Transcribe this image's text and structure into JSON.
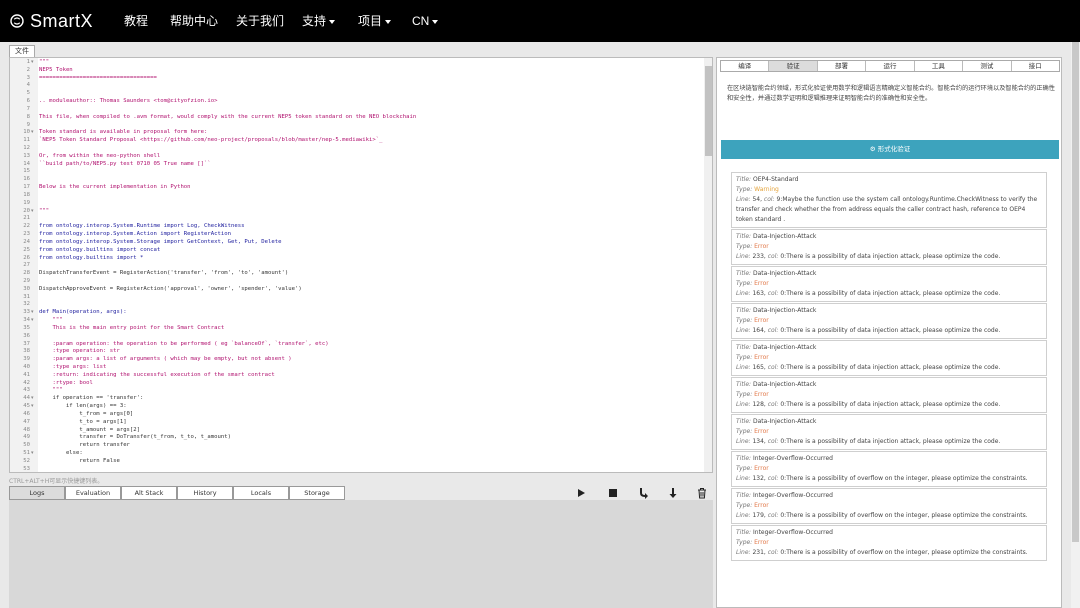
{
  "header": {
    "brand": "SmartX",
    "nav": [
      {
        "label": "教程",
        "dropdown": false
      },
      {
        "label": "帮助中心",
        "dropdown": false
      },
      {
        "label": "关于我们",
        "dropdown": false
      },
      {
        "label": "支持",
        "dropdown": true
      },
      {
        "label": "项目",
        "dropdown": true
      },
      {
        "label": "CN",
        "dropdown": true
      }
    ]
  },
  "editor": {
    "file_tab": "文件",
    "lines": [
      "\"\"\"",
      "NEP5 Token",
      "===================================",
      "",
      "",
      ".. moduleauthor:: Thomas Saunders <tom@cityofzion.io>",
      "",
      "This file, when compiled to .avm format, would comply with the current NEP5 token standard on the NEO blockchain",
      "",
      "Token standard is available in proposal form here:",
      "`NEP5 Token Standard Proposal <https://github.com/neo-project/proposals/blob/master/nep-5.mediawiki>`_",
      "",
      "Or, from within the neo-python shell",
      "``build path/to/NEP5.py test 0710 05 True name []``",
      "",
      "",
      "Below is the current implementation in Python",
      "",
      "",
      "\"\"\"",
      "",
      "from ontology.interop.System.Runtime import Log, CheckWitness",
      "from ontology.interop.System.Action import RegisterAction",
      "from ontology.interop.System.Storage import GetContext, Get, Put, Delete",
      "from ontology.builtins import concat",
      "from ontology.builtins import *",
      "",
      "DispatchTransferEvent = RegisterAction('transfer', 'from', 'to', 'amount')",
      "",
      "DispatchApproveEvent = RegisterAction('approval', 'owner', 'spender', 'value')",
      "",
      "",
      "def Main(operation, args):",
      "    \"\"\"",
      "    This is the main entry point for the Smart Contract",
      "",
      "    :param operation: the operation to be performed ( eg `balanceOf`, `transfer`, etc)",
      "    :type operation: str",
      "    :param args: a list of arguments ( which may be empty, but not absent )",
      "    :type args: list",
      "    :return: indicating the successful execution of the smart contract",
      "    :rtype: bool",
      "    \"\"\"",
      "    if operation == 'transfer':",
      "        if len(args) == 3:",
      "            t_from = args[0]",
      "            t_to = args[1]",
      "            t_amount = args[2]",
      "            transfer = DoTransfer(t_from, t_to, t_amount)",
      "            return transfer",
      "        else:",
      "            return False",
      ""
    ],
    "fold_lines": [
      1,
      10,
      20,
      33,
      34,
      44,
      45,
      51
    ],
    "hint": "CTRL+ALT+H可显示快捷键列表。"
  },
  "debug_tabs": [
    "Logs",
    "Evaluation Stack",
    "Alt Stack",
    "History",
    "Locals",
    "Storage"
  ],
  "controls": [
    "play-icon",
    "stop-icon",
    "step-over-icon",
    "step-into-icon",
    "trash-icon"
  ],
  "right": {
    "tabs": [
      "编译",
      "验证",
      "部署",
      "运行",
      "工具",
      "测试",
      "接口"
    ],
    "active_tab": "验证",
    "description": "在区块链智能合约领域，形式化验证使用数学和逻辑语言精确定义智能合约。智能合约的运行环境以及智能合约的正确性和安全性，并通过数学证明和逻辑推理来证明智能合约的准确性和安全性。",
    "verify_button": "形式化验证",
    "labels": {
      "title": "Title:",
      "type": "Type:",
      "line": "Line:",
      "col": "col:"
    },
    "results": [
      {
        "title": "OEP4-Standard",
        "type": "Warning",
        "line": "54",
        "col": "9",
        "message": "Maybe the function use the system call ontology.Runtime.CheckWitness to verify the transfer and check whether the from address equals the caller contract hash, reference to OEP4 token standard ."
      },
      {
        "title": "Data-Injection-Attack",
        "type": "Error",
        "line": "233",
        "col": "0",
        "message": "There is a possibility of data injection attack, please optimize the code."
      },
      {
        "title": "Data-Injection-Attack",
        "type": "Error",
        "line": "163",
        "col": "0",
        "message": "There is a possibility of data injection attack, please optimize the code."
      },
      {
        "title": "Data-Injection-Attack",
        "type": "Error",
        "line": "164",
        "col": "0",
        "message": "There is a possibility of data injection attack, please optimize the code."
      },
      {
        "title": "Data-Injection-Attack",
        "type": "Error",
        "line": "165",
        "col": "0",
        "message": "There is a possibility of data injection attack, please optimize the code."
      },
      {
        "title": "Data-Injection-Attack",
        "type": "Error",
        "line": "128",
        "col": "0",
        "message": "There is a possibility of data injection attack, please optimize the code."
      },
      {
        "title": "Data-Injection-Attack",
        "type": "Error",
        "line": "134",
        "col": "0",
        "message": "There is a possibility of data injection attack, please optimize the code."
      },
      {
        "title": "Integer-Overflow-Occurred",
        "type": "Error",
        "line": "132",
        "col": "0",
        "message": "There is a possibility of overflow on the integer, please optimize the constraints."
      },
      {
        "title": "Integer-Overflow-Occurred",
        "type": "Error",
        "line": "179",
        "col": "0",
        "message": "There is a possibility of overflow on the integer, please optimize the constraints."
      },
      {
        "title": "Integer-Overflow-Occurred",
        "type": "Error",
        "line": "231",
        "col": "0",
        "message": "There is a possibility of overflow on the integer, please optimize the constraints."
      }
    ]
  }
}
